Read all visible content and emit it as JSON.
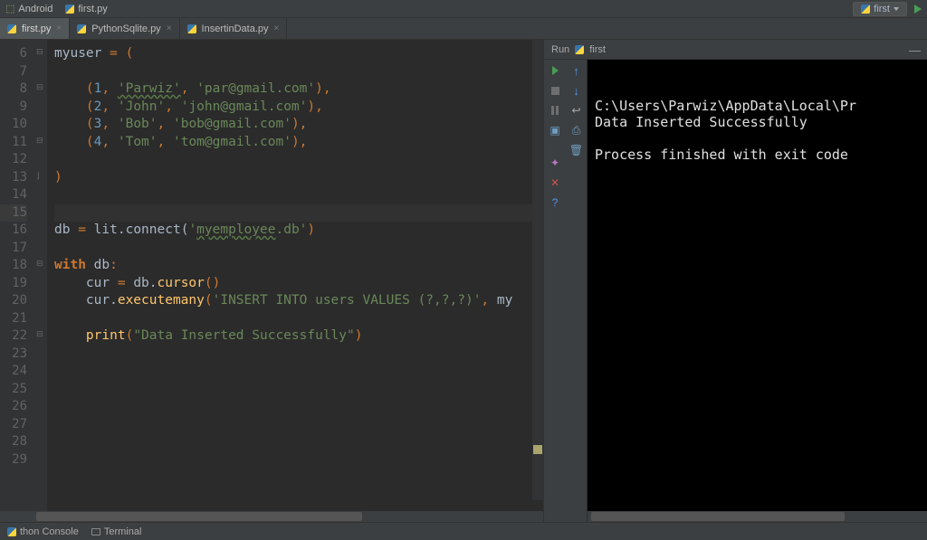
{
  "topbar": {
    "left": [
      {
        "name": "android-item",
        "label": "Android"
      },
      {
        "name": "python-file-item",
        "label": "first.py"
      }
    ],
    "run_config_label": "first"
  },
  "tabs": [
    {
      "name": "tab-first",
      "label": "first.py",
      "active": true
    },
    {
      "name": "tab-pythonsqlite",
      "label": "PythonSqlite.py",
      "active": false
    },
    {
      "name": "tab-insertindata",
      "label": "InsertinData.py",
      "active": false
    }
  ],
  "editor": {
    "first_line_no": 6,
    "last_line_no": 29,
    "current_line": 15,
    "tokens": {
      "l6": [
        [
          "id",
          "myuser "
        ],
        [
          "punct",
          "= ("
        ]
      ],
      "l7": [],
      "l8": [
        [
          "punct",
          "    ("
        ],
        [
          "num",
          "1"
        ],
        [
          "punct",
          ", "
        ],
        [
          "str-u",
          "'Parwiz'"
        ],
        [
          "punct",
          ", "
        ],
        [
          "str",
          "'par@gmail.com'"
        ],
        [
          "punct",
          "),"
        ]
      ],
      "l9": [
        [
          "punct",
          "    ("
        ],
        [
          "num",
          "2"
        ],
        [
          "punct",
          ", "
        ],
        [
          "str",
          "'John'"
        ],
        [
          "punct",
          ", "
        ],
        [
          "str",
          "'john@gmail.com'"
        ],
        [
          "punct",
          "),"
        ]
      ],
      "l10": [
        [
          "punct",
          "    ("
        ],
        [
          "num",
          "3"
        ],
        [
          "punct",
          ", "
        ],
        [
          "str",
          "'Bob'"
        ],
        [
          "punct",
          ", "
        ],
        [
          "str",
          "'bob@gmail.com'"
        ],
        [
          "punct",
          "),"
        ]
      ],
      "l11": [
        [
          "punct",
          "    ("
        ],
        [
          "num",
          "4"
        ],
        [
          "punct",
          ", "
        ],
        [
          "str",
          "'Tom'"
        ],
        [
          "punct",
          ", "
        ],
        [
          "str",
          "'tom@gmail.com'"
        ],
        [
          "punct",
          "),"
        ]
      ],
      "l12": [],
      "l13": [
        [
          "punct",
          ")"
        ]
      ],
      "l14": [],
      "l15": [],
      "l16": [
        [
          "id",
          "db "
        ],
        [
          "punct",
          "= "
        ],
        [
          "id",
          "lit.connect("
        ],
        [
          "str",
          "'"
        ],
        [
          "str-u",
          "myemployee"
        ],
        [
          "str",
          ".db'"
        ],
        [
          "punct",
          ")"
        ]
      ],
      "l17": [],
      "l18": [
        [
          "kw",
          "with "
        ],
        [
          "id",
          "db"
        ],
        [
          "punct",
          ":"
        ]
      ],
      "l19": [
        [
          "id",
          "    cur "
        ],
        [
          "punct",
          "= "
        ],
        [
          "id",
          "db."
        ],
        [
          "fn",
          "cursor"
        ],
        [
          "punct",
          "()"
        ]
      ],
      "l20": [
        [
          "id",
          "    cur."
        ],
        [
          "fn",
          "executemany"
        ],
        [
          "punct",
          "("
        ],
        [
          "str",
          "'INSERT INTO users VALUES (?,?,?)'"
        ],
        [
          "punct",
          ", "
        ],
        [
          "id",
          "my"
        ]
      ],
      "l21": [],
      "l22": [
        [
          "id",
          "    "
        ],
        [
          "fn",
          "print"
        ],
        [
          "punct",
          "("
        ],
        [
          "str",
          "\"Data Inserted Successfully\""
        ],
        [
          "punct",
          ")"
        ]
      ],
      "l23": [],
      "l24": [],
      "l25": [],
      "l26": [],
      "l27": [],
      "l28": [],
      "l29": []
    }
  },
  "run": {
    "header_label": "Run",
    "config_name": "first",
    "output_lines": [
      "C:\\Users\\Parwiz\\AppData\\Local\\Pr",
      "Data Inserted Successfully",
      "",
      "Process finished with exit code "
    ]
  },
  "bottom": {
    "items": [
      {
        "name": "python-console-item",
        "label": "thon Console"
      },
      {
        "name": "terminal-item",
        "label": "Terminal"
      }
    ]
  }
}
